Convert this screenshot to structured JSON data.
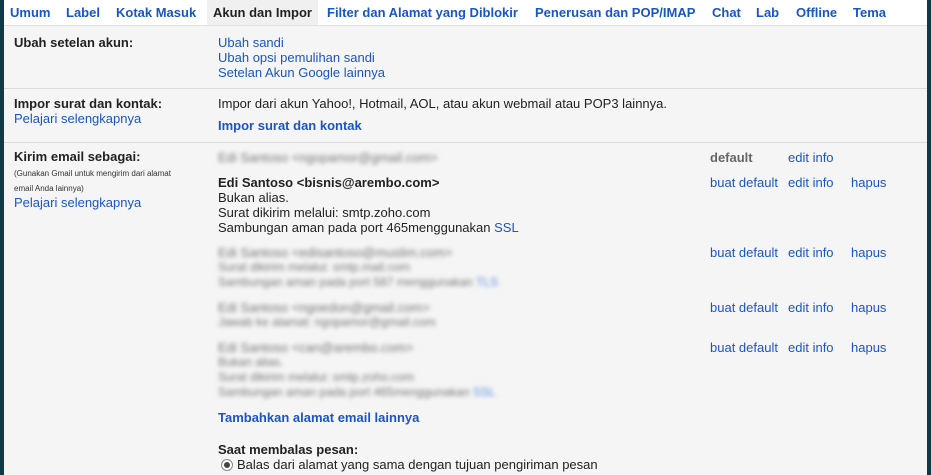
{
  "tabs": [
    "Umum",
    "Label",
    "Kotak Masuk",
    "Akun dan Impor",
    "Filter dan Alamat yang Diblokir",
    "Penerusan dan POP/IMAP",
    "Chat",
    "Lab",
    "Offline",
    "Tema"
  ],
  "change_settings": {
    "label": "Ubah setelan akun:",
    "links": [
      "Ubah sandi",
      "Ubah opsi pemulihan sandi",
      "Setelan Akun Google lainnya"
    ]
  },
  "import": {
    "label": "Impor surat dan kontak:",
    "learn_more": "Pelajari selengkapnya",
    "description": "Impor dari akun Yahoo!, Hotmail, AOL, atau akun webmail atau POP3 lainnya.",
    "action": "Impor surat dan kontak"
  },
  "send_as": {
    "label": "Kirim email sebagai:",
    "note_line1": "(Gunakan Gmail untuk mengirim dari alamat",
    "note_line2": "email Anda lainnya)",
    "learn_more": "Pelajari selengkapnya",
    "accounts": [
      {
        "name": "Edi Santoso <ngopamor@gmail.com>",
        "status": "default",
        "edit": "edit info"
      },
      {
        "name": "Edi Santoso <bisnis@arembo.com>",
        "l1": "Bukan alias.",
        "l2": "Surat dikirim melalui: smtp.zoho.com",
        "l3": "Sambungan aman pada port 465menggunakan",
        "l3_link": "SSL",
        "make_default": "buat default",
        "edit": "edit info",
        "delete": "hapus"
      },
      {
        "name": "Edi Santoso <edisantoso@muslim.com>",
        "l1": "Surat dikirim melalui: smtp.mail.com",
        "l2": "Sambungan aman pada port 587 menggunakan",
        "l2_link": "TLS",
        "make_default": "buat default",
        "edit": "edit info",
        "delete": "hapus"
      },
      {
        "name": "Edi Santoso <ngoedon@gmail.com>",
        "l1": "Jawab ke alamat: ngopamor@gmail.com",
        "make_default": "buat default",
        "edit": "edit info",
        "delete": "hapus"
      },
      {
        "name": "Edi Santoso <can@arembo.com>",
        "l1": "Bukan alias.",
        "l2": "Surat dikirim melalui: smtp.zoho.com",
        "l3": "Sambungan aman pada port 465menggunakan",
        "l3_link": "SSL",
        "make_default": "buat default",
        "edit": "edit info",
        "delete": "hapus"
      }
    ],
    "add_address": "Tambahkan alamat email lainnya",
    "reply_label": "Saat membalas pesan:",
    "reply_option": "Balas dari alamat yang sama dengan tujuan pengiriman pesan"
  }
}
